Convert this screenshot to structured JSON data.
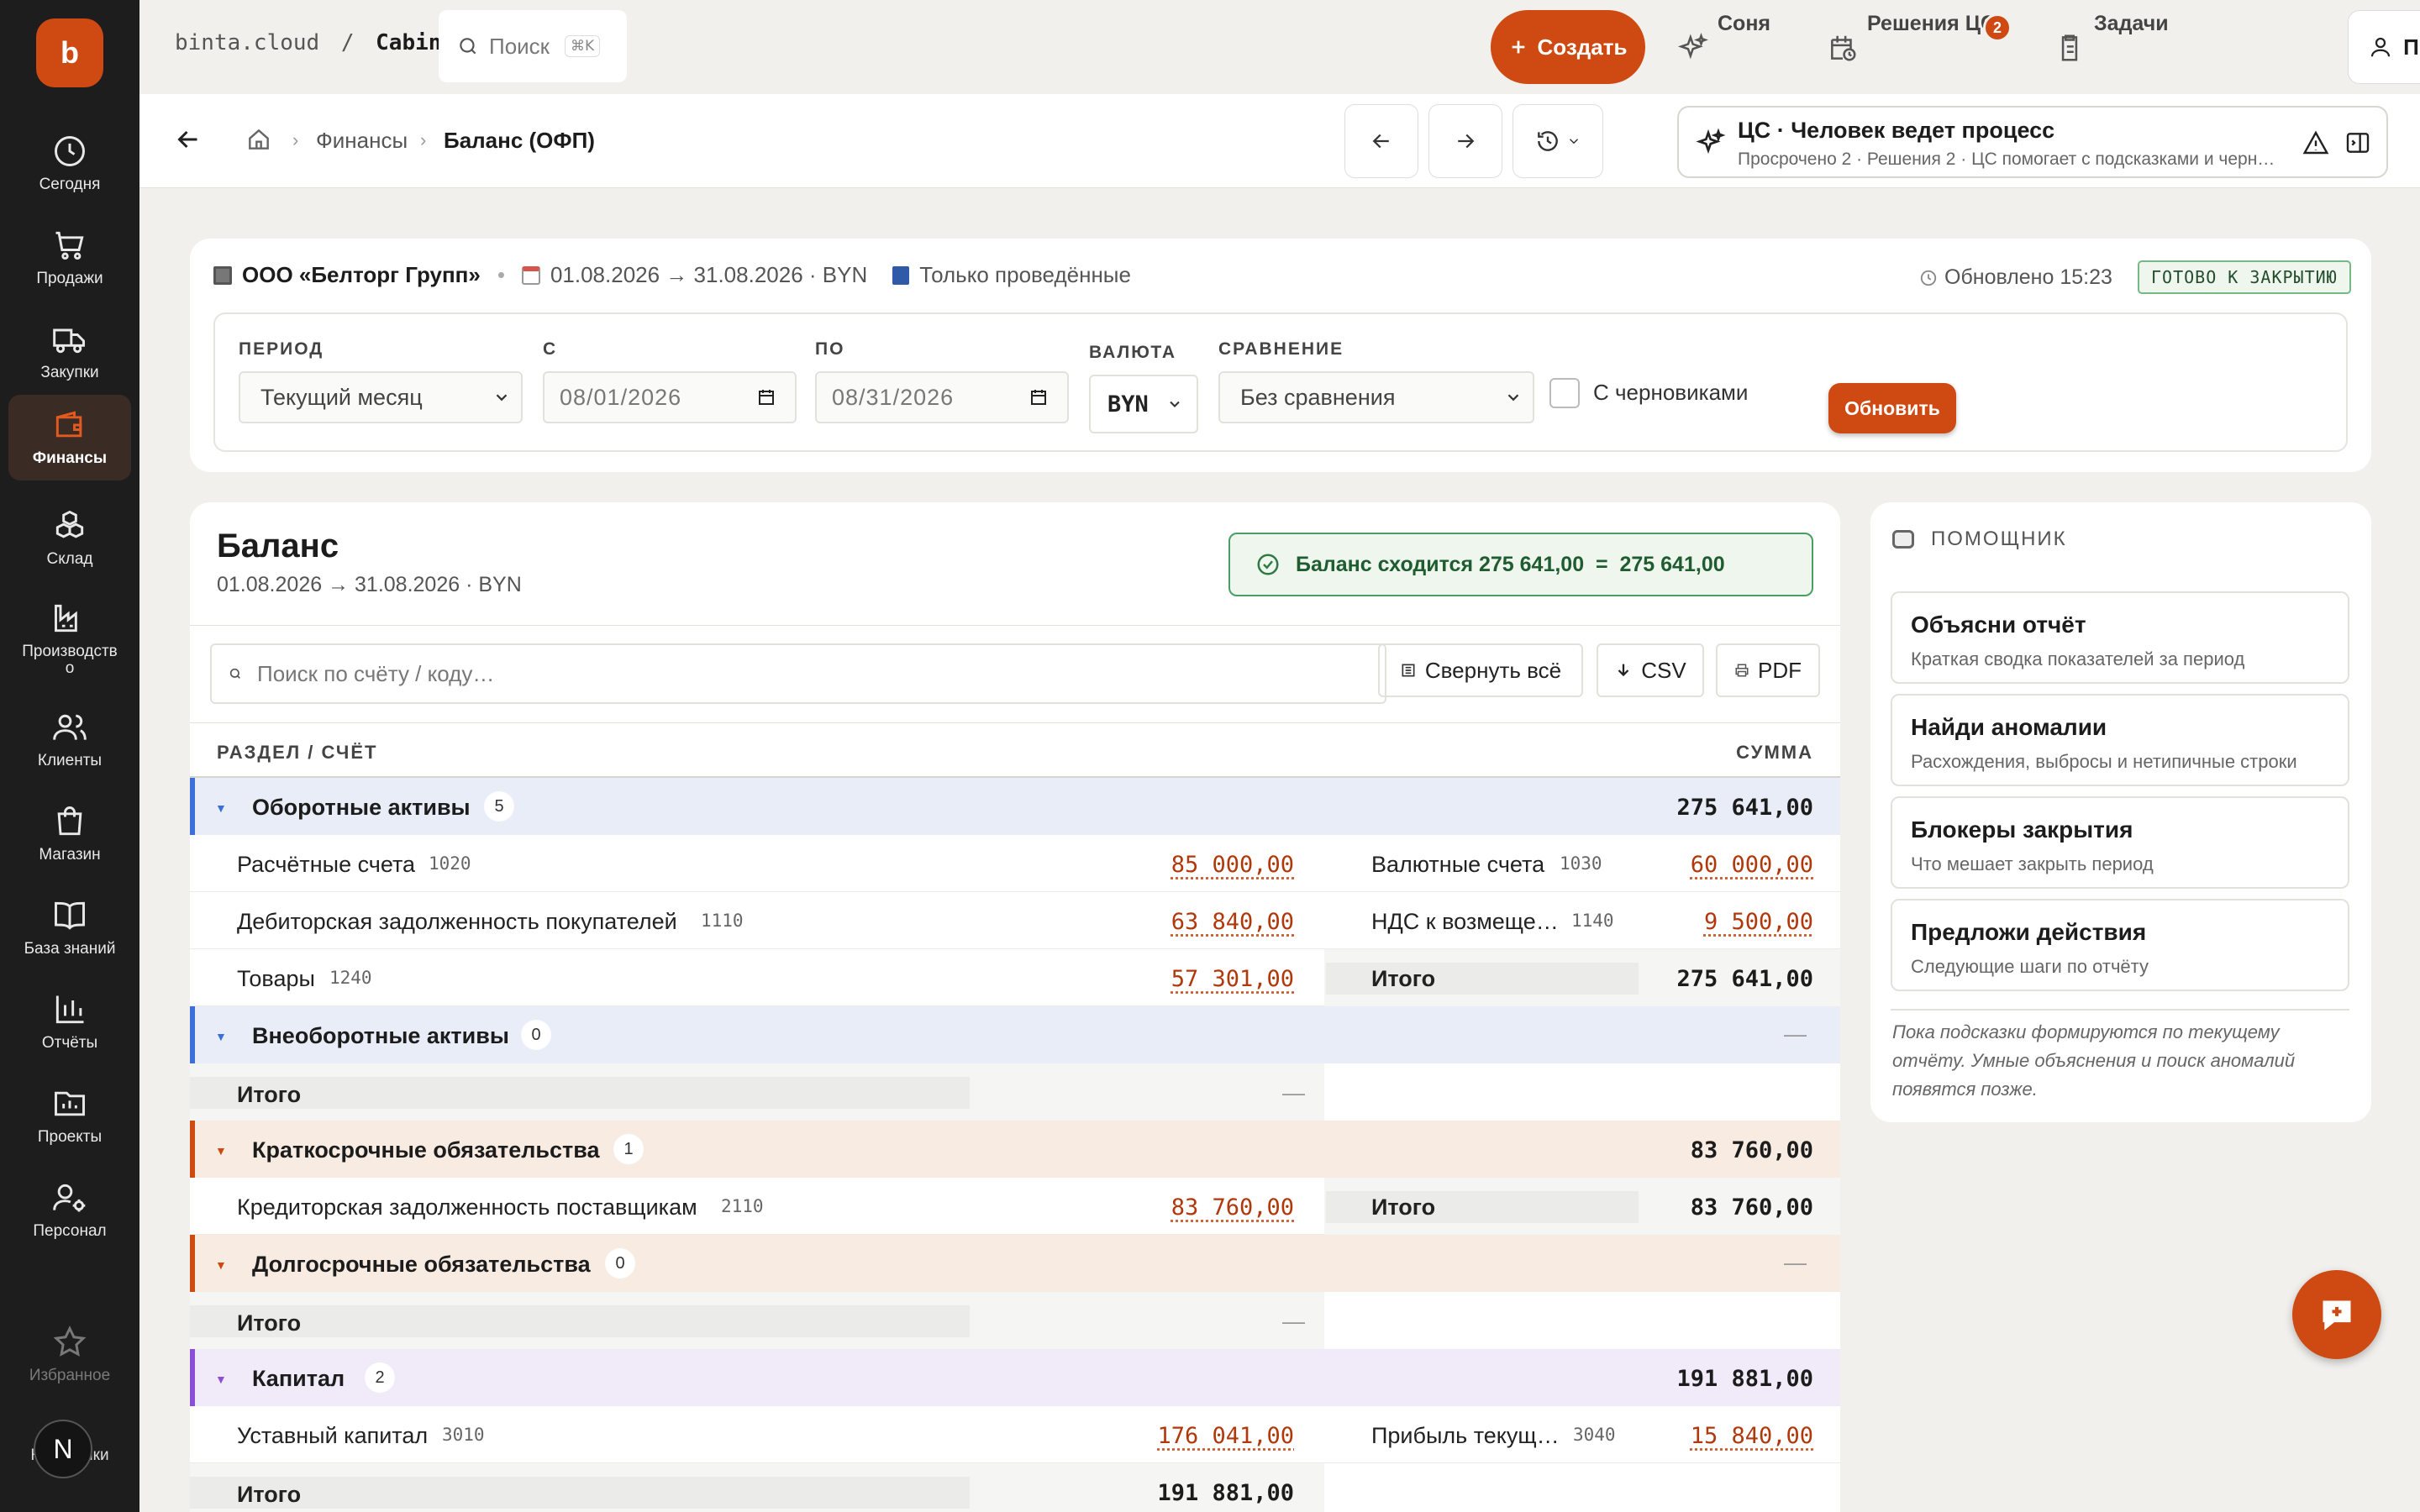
{
  "app": {
    "logo_letter": "b",
    "accent": "#cf4a12"
  },
  "sidebar": {
    "items": [
      {
        "label": "Сегодня",
        "icon": "clock-icon"
      },
      {
        "label": "Продажи",
        "icon": "cart-icon"
      },
      {
        "label": "Закупки",
        "icon": "truck-icon"
      },
      {
        "label": "Финансы",
        "icon": "wallet-icon",
        "active": true
      },
      {
        "label": "Склад",
        "icon": "boxes-icon"
      },
      {
        "label": "Производство",
        "label_line1": "Производств",
        "label_line2": "о",
        "icon": "factory-icon"
      },
      {
        "label": "Клиенты",
        "icon": "users-icon"
      },
      {
        "label": "Магазин",
        "icon": "shop-icon"
      },
      {
        "label": "База знаний",
        "icon": "book-icon"
      },
      {
        "label": "Отчёты",
        "icon": "chart-icon"
      },
      {
        "label": "Проекты",
        "icon": "project-icon"
      },
      {
        "label": "Персонал",
        "icon": "user-gear-icon"
      }
    ],
    "favorites": "Избранное",
    "settings": "Настройки",
    "avatar_letter": "N"
  },
  "topbar": {
    "domain": "binta.cloud",
    "sep": "/",
    "workspace": "Cabinet",
    "search_placeholder": "Поиск",
    "search_kbd": "⌘K",
    "create": "Создать",
    "sonya": "Соня",
    "decisions": "Решения ЦС",
    "decisions_badge": "2",
    "tasks": "Задачи",
    "profile": "Профиль"
  },
  "breadcrumb": {
    "section": "Финансы",
    "page": "Баланс (ОФП)"
  },
  "cs_panel": {
    "title": "ЦС · Человек ведет процесс",
    "subtitle": "Просрочено 2 · Решения 2 · ЦС помогает с подсказками и черновиками"
  },
  "filter": {
    "company": "ООО «Белторг Групп»",
    "dot": "•",
    "period_range": "01.08.2026 → 31.08.2026 · BYN",
    "mode": "Только проведённые",
    "updated": "Обновлено 15:23",
    "status": "ГОТОВО К ЗАКРЫТИЮ",
    "period_label": "ПЕРИОД",
    "period_value": "Текущий месяц",
    "from_label": "С",
    "from_value": "08/01/2026",
    "to_label": "ПО",
    "to_value": "08/31/2026",
    "currency_label": "ВАЛЮТА",
    "currency_value": "BYN",
    "compare_label": "СРАВНЕНИЕ",
    "compare_value": "Без сравнения",
    "drafts_label": "С черновиками",
    "refresh": "Обновить"
  },
  "balance": {
    "title": "Баланс",
    "subtitle": "01.08.2026 → 31.08.2026 · BYN",
    "check": "Баланс сходится 275 641,00  =  275 641,00",
    "search_placeholder": "Поиск по счёту / коду…",
    "collapse": "Свернуть всё",
    "csv": "CSV",
    "pdf": "PDF",
    "col_account": "РАЗДЕЛ / СЧЁТ",
    "col_sum": "СУММА",
    "total_label": "Итого",
    "dash": "—",
    "sections": [
      {
        "name": "Оборотные активы",
        "count": "5",
        "total": "275 641,00",
        "color": "#3b6fd9",
        "bg": "#e9edf8"
      },
      {
        "name": "Внеоборотные активы",
        "count": "0",
        "total": "—",
        "color": "#3b6fd9",
        "bg": "#e9edf8"
      },
      {
        "name": "Краткосрочные обязательства",
        "count": "1",
        "total": "83 760,00",
        "color": "#cf4a12",
        "bg": "#f8ebe2"
      },
      {
        "name": "Долгосрочные обязательства",
        "count": "0",
        "total": "—",
        "color": "#cf4a12",
        "bg": "#f8ebe2"
      },
      {
        "name": "Капитал",
        "count": "2",
        "total": "191 881,00",
        "color": "#8a4fd6",
        "bg": "#f0eaf9"
      }
    ],
    "accounts": {
      "a1020": {
        "name": "Расчётные счета",
        "code": "1020",
        "amount": "85 000,00"
      },
      "a1030": {
        "name": "Валютные счета",
        "code": "1030",
        "amount": "60 000,00"
      },
      "a1110": {
        "name": "Дебиторская задолженность покупателей",
        "code": "1110",
        "amount": "63 840,00"
      },
      "a1140": {
        "name": "НДС к возмеще…",
        "code": "1140",
        "amount": "9 500,00"
      },
      "a1240": {
        "name": "Товары",
        "code": "1240",
        "amount": "57 301,00"
      },
      "a2110": {
        "name": "Кредиторская задолженность поставщикам",
        "code": "2110",
        "amount": "83 760,00"
      },
      "a3010": {
        "name": "Уставный капитал",
        "code": "3010",
        "amount": "176 041,00"
      },
      "a3040": {
        "name": "Прибыль текущ…",
        "code": "3040",
        "amount": "15 840,00"
      }
    },
    "totals": {
      "current_assets": "275 641,00",
      "short_liab": "83 760,00",
      "capital": "191 881,00"
    }
  },
  "assistant": {
    "title": "ПОМОЩНИК",
    "cards": [
      {
        "title": "Объясни отчёт",
        "desc": "Краткая сводка показателей за период"
      },
      {
        "title": "Найди аномалии",
        "desc": "Расхождения, выбросы и нетипичные строки"
      },
      {
        "title": "Блокеры закрытия",
        "desc": "Что мешает закрыть период"
      },
      {
        "title": "Предложи действия",
        "desc": "Следующие шаги по отчёту"
      }
    ],
    "note": "Пока подсказки формируются по текущему отчёту. Умные объяснения и поиск аномалий появятся позже."
  }
}
